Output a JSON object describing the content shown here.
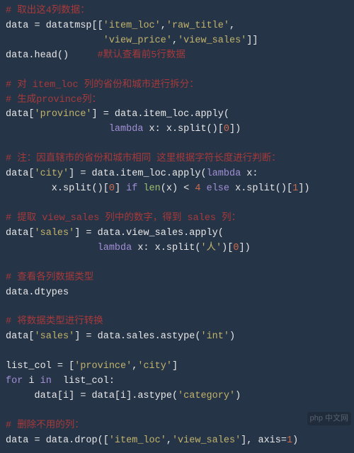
{
  "lines": [
    {
      "t": "cmt",
      "v": "# 取出这4列数据："
    },
    {
      "t": "raw",
      "segs": [
        {
          "c": "p",
          "v": "data = datatmsp[["
        },
        {
          "c": "s",
          "v": "'item_loc'"
        },
        {
          "c": "p",
          "v": ","
        },
        {
          "c": "s",
          "v": "'raw_title'"
        },
        {
          "c": "p",
          "v": ","
        }
      ]
    },
    {
      "t": "raw",
      "segs": [
        {
          "c": "p",
          "v": "                 "
        },
        {
          "c": "s",
          "v": "'view_price'"
        },
        {
          "c": "p",
          "v": ","
        },
        {
          "c": "s",
          "v": "'view_sales'"
        },
        {
          "c": "p",
          "v": "]]"
        }
      ]
    },
    {
      "t": "raw",
      "segs": [
        {
          "c": "p",
          "v": "data.head()     "
        },
        {
          "c": "c",
          "v": "#默认查看前5行数据"
        }
      ]
    },
    {
      "t": "blank"
    },
    {
      "t": "cmt",
      "v": "# 对 item_loc 列的省份和城市进行拆分："
    },
    {
      "t": "cmt",
      "v": "# 生成province列："
    },
    {
      "t": "raw",
      "segs": [
        {
          "c": "p",
          "v": "data["
        },
        {
          "c": "s",
          "v": "'province'"
        },
        {
          "c": "p",
          "v": "] = data.item_loc.apply("
        }
      ]
    },
    {
      "t": "raw",
      "segs": [
        {
          "c": "p",
          "v": "                  "
        },
        {
          "c": "k",
          "v": "lambda"
        },
        {
          "c": "p",
          "v": " x: x.split()["
        },
        {
          "c": "n",
          "v": "0"
        },
        {
          "c": "p",
          "v": "])"
        }
      ]
    },
    {
      "t": "blank"
    },
    {
      "t": "cmt",
      "v": "# 注：因直辖市的省份和城市相同 这里根据字符长度进行判断："
    },
    {
      "t": "raw",
      "segs": [
        {
          "c": "p",
          "v": "data["
        },
        {
          "c": "s",
          "v": "'city'"
        },
        {
          "c": "p",
          "v": "] = data.item_loc.apply("
        },
        {
          "c": "k",
          "v": "lambda"
        },
        {
          "c": "p",
          "v": " x:"
        }
      ]
    },
    {
      "t": "raw",
      "segs": [
        {
          "c": "p",
          "v": "        x.split()["
        },
        {
          "c": "n",
          "v": "0"
        },
        {
          "c": "p",
          "v": "] "
        },
        {
          "c": "k",
          "v": "if"
        },
        {
          "c": "p",
          "v": " "
        },
        {
          "c": "f",
          "v": "len"
        },
        {
          "c": "p",
          "v": "(x) < "
        },
        {
          "c": "n",
          "v": "4"
        },
        {
          "c": "p",
          "v": " "
        },
        {
          "c": "k",
          "v": "else"
        },
        {
          "c": "p",
          "v": " x.split()["
        },
        {
          "c": "n",
          "v": "1"
        },
        {
          "c": "p",
          "v": "])"
        }
      ]
    },
    {
      "t": "blank"
    },
    {
      "t": "cmt",
      "v": "# 提取 view_sales 列中的数字，得到 sales 列："
    },
    {
      "t": "raw",
      "segs": [
        {
          "c": "p",
          "v": "data["
        },
        {
          "c": "s",
          "v": "'sales'"
        },
        {
          "c": "p",
          "v": "] = data.view_sales.apply("
        }
      ]
    },
    {
      "t": "raw",
      "segs": [
        {
          "c": "p",
          "v": "                "
        },
        {
          "c": "k",
          "v": "lambda"
        },
        {
          "c": "p",
          "v": " x: x.split("
        },
        {
          "c": "s",
          "v": "'人'"
        },
        {
          "c": "p",
          "v": ")["
        },
        {
          "c": "n",
          "v": "0"
        },
        {
          "c": "p",
          "v": "])"
        }
      ]
    },
    {
      "t": "blank"
    },
    {
      "t": "cmt",
      "v": "# 查看各列数据类型"
    },
    {
      "t": "raw",
      "segs": [
        {
          "c": "p",
          "v": "data.dtypes"
        }
      ]
    },
    {
      "t": "blank"
    },
    {
      "t": "cmt",
      "v": "# 将数据类型进行转换"
    },
    {
      "t": "raw",
      "segs": [
        {
          "c": "p",
          "v": "data["
        },
        {
          "c": "s",
          "v": "'sales'"
        },
        {
          "c": "p",
          "v": "] = data.sales.astype("
        },
        {
          "c": "s",
          "v": "'int'"
        },
        {
          "c": "p",
          "v": ")"
        }
      ]
    },
    {
      "t": "blank"
    },
    {
      "t": "raw",
      "segs": [
        {
          "c": "p",
          "v": "list_col = ["
        },
        {
          "c": "s",
          "v": "'province'"
        },
        {
          "c": "p",
          "v": ","
        },
        {
          "c": "s",
          "v": "'city'"
        },
        {
          "c": "p",
          "v": "]"
        }
      ]
    },
    {
      "t": "raw",
      "segs": [
        {
          "c": "k",
          "v": "for"
        },
        {
          "c": "p",
          "v": " i "
        },
        {
          "c": "k",
          "v": "in"
        },
        {
          "c": "p",
          "v": "  list_col:"
        }
      ]
    },
    {
      "t": "raw",
      "segs": [
        {
          "c": "p",
          "v": "     data[i] = data[i].astype("
        },
        {
          "c": "s",
          "v": "'category'"
        },
        {
          "c": "p",
          "v": ")"
        }
      ]
    },
    {
      "t": "blank"
    },
    {
      "t": "cmt",
      "v": "# 删除不用的列："
    },
    {
      "t": "raw",
      "segs": [
        {
          "c": "p",
          "v": "data = data.drop(["
        },
        {
          "c": "s",
          "v": "'item_loc'"
        },
        {
          "c": "p",
          "v": ","
        },
        {
          "c": "s",
          "v": "'view_sales'"
        },
        {
          "c": "p",
          "v": "], axis="
        },
        {
          "c": "n",
          "v": "1"
        },
        {
          "c": "p",
          "v": ")"
        }
      ]
    }
  ],
  "watermark": "php 中文网"
}
